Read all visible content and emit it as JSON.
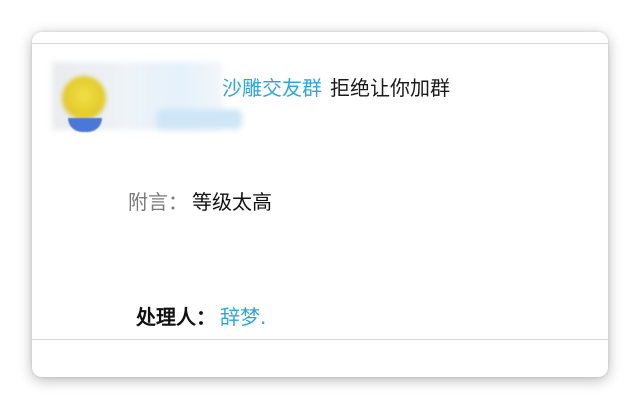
{
  "notification": {
    "group_name": "沙雕交友群",
    "action_text": "拒绝让你加群",
    "note_label": "附言：",
    "note_value": "等级太高",
    "handler_label": "处理人：",
    "handler_name": "辞梦."
  },
  "colors": {
    "link": "#2fa5dd",
    "text": "#1a1a1a",
    "muted": "#7a7a7a",
    "divider": "#cfdcdf"
  }
}
